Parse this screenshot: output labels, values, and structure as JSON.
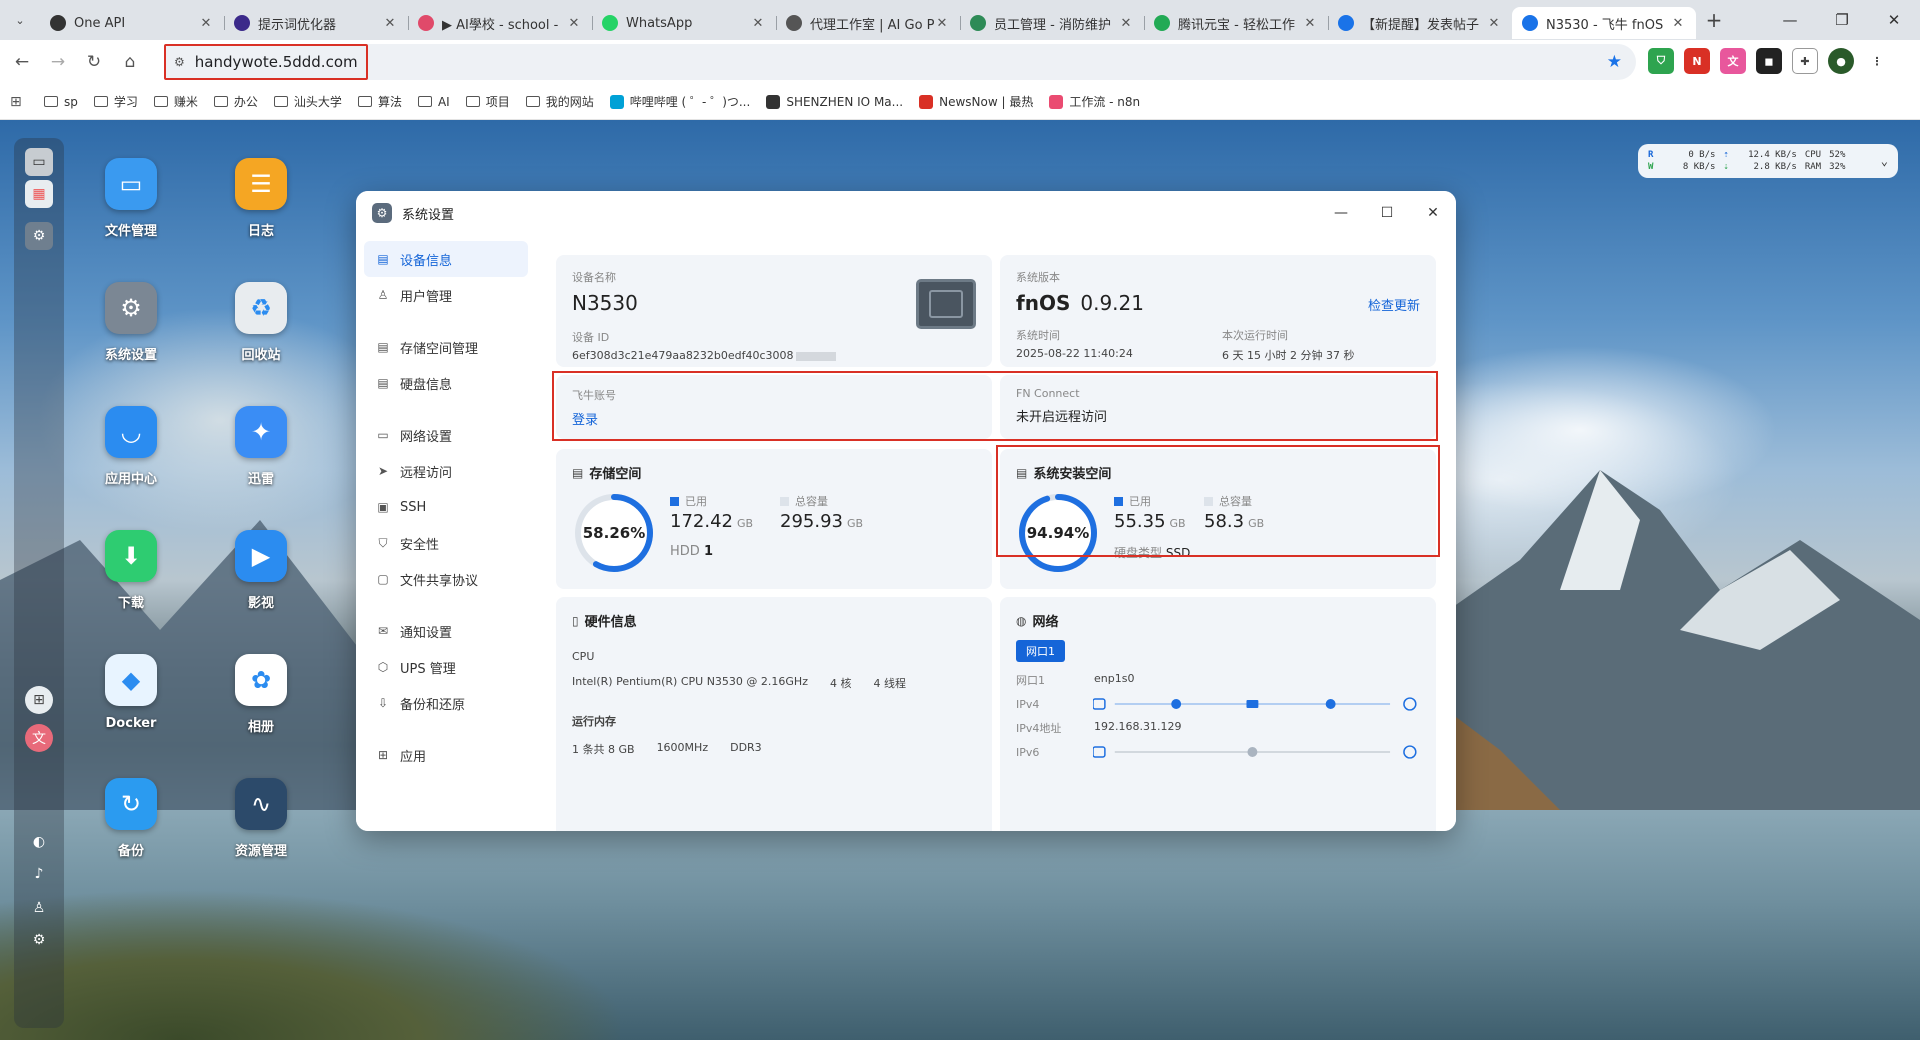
{
  "browser": {
    "tabs": [
      {
        "title": "One API",
        "color": "#333333",
        "active": false
      },
      {
        "title": "提示词优化器",
        "color": "#3b2a8a",
        "active": false
      },
      {
        "title": "▶ AI學校 - school -",
        "color": "#e04a6a",
        "active": false
      },
      {
        "title": "WhatsApp",
        "color": "#25d366",
        "active": false
      },
      {
        "title": "代理工作室 | AI Go P",
        "color": "#555555",
        "active": false
      },
      {
        "title": "员工管理 - 消防维护",
        "color": "#2e8b57",
        "active": false
      },
      {
        "title": "腾讯元宝 - 轻松工作",
        "color": "#22aa55",
        "active": false
      },
      {
        "title": "【新提醒】发表帖子",
        "color": "#1a73e8",
        "active": false
      },
      {
        "title": "N3530 - 飞牛 fnOS",
        "color": "#1a73e8",
        "active": true
      }
    ],
    "url": "handywote.5ddd.com",
    "bookmarks": [
      {
        "label": "sp",
        "type": "folder"
      },
      {
        "label": "学习",
        "type": "folder"
      },
      {
        "label": "赚米",
        "type": "folder"
      },
      {
        "label": "办公",
        "type": "folder"
      },
      {
        "label": "汕头大学",
        "type": "folder"
      },
      {
        "label": "算法",
        "type": "folder"
      },
      {
        "label": "AI",
        "type": "folder"
      },
      {
        "label": "项目",
        "type": "folder"
      },
      {
        "label": "我的网站",
        "type": "folder"
      },
      {
        "label": "哔哩哔哩 ( ゜- ゜)つ...",
        "type": "site",
        "color": "#00a1d6"
      },
      {
        "label": "SHENZHEN IO Ma...",
        "type": "site",
        "color": "#333333"
      },
      {
        "label": "NewsNow | 最热",
        "type": "site",
        "color": "#d93025"
      },
      {
        "label": "工作流 - n8n",
        "type": "site",
        "color": "#ea4b71"
      }
    ]
  },
  "desktop": {
    "icons": [
      {
        "label": "文件管理",
        "color": "#3a9af0",
        "glyph": "▭"
      },
      {
        "label": "日志",
        "color": "#f5a623",
        "glyph": "☰"
      },
      {
        "label": "系统设置",
        "color": "#7b8794",
        "glyph": "⚙"
      },
      {
        "label": "回收站",
        "color": "#e8ecef",
        "glyph": "♻"
      },
      {
        "label": "应用中心",
        "color": "#2b8cf0",
        "glyph": "◡"
      },
      {
        "label": "迅雷",
        "color": "#3a8df5",
        "glyph": "✦"
      },
      {
        "label": "下载",
        "color": "#2ecc71",
        "glyph": "⬇"
      },
      {
        "label": "影视",
        "color": "#2b8cf0",
        "glyph": "▶"
      },
      {
        "label": "Docker",
        "color": "#e8f4ff",
        "glyph": "◆"
      },
      {
        "label": "相册",
        "color": "#ffffff",
        "glyph": "✿"
      },
      {
        "label": "备份",
        "color": "#2b9bf0",
        "glyph": "↻"
      },
      {
        "label": "资源管理",
        "color": "#2c4a6a",
        "glyph": "∿"
      }
    ],
    "monitor": {
      "r_label": "R",
      "w_label": "W",
      "r_disk": "0  B/s",
      "w_disk": "8 KB/s",
      "up": "12.4 KB/s",
      "down": "2.8 KB/s",
      "cpu_label": "CPU",
      "ram_label": "RAM",
      "cpu": "52%",
      "ram": "32%"
    }
  },
  "window": {
    "title": "系统设置",
    "sidebar": [
      {
        "label": "设备信息",
        "icon": "▤",
        "active": true
      },
      {
        "label": "用户管理",
        "icon": "♙",
        "active": false
      },
      {
        "gap": true
      },
      {
        "label": "存储空间管理",
        "icon": "▤",
        "active": false
      },
      {
        "label": "硬盘信息",
        "icon": "▤",
        "active": false
      },
      {
        "gap": true
      },
      {
        "label": "网络设置",
        "icon": "▭",
        "active": false
      },
      {
        "label": "远程访问",
        "icon": "➤",
        "active": false
      },
      {
        "label": "SSH",
        "icon": "▣",
        "active": false
      },
      {
        "label": "安全性",
        "icon": "⛉",
        "active": false
      },
      {
        "label": "文件共享协议",
        "icon": "▢",
        "active": false
      },
      {
        "gap": true
      },
      {
        "label": "通知设置",
        "icon": "✉",
        "active": false
      },
      {
        "label": "UPS 管理",
        "icon": "⬡",
        "active": false
      },
      {
        "label": "备份和还原",
        "icon": "⇩",
        "active": false
      },
      {
        "gap": true
      },
      {
        "label": "应用",
        "icon": "⊞",
        "active": false
      }
    ],
    "device": {
      "name_label": "设备名称",
      "name": "N3530",
      "id_label": "设备 ID",
      "id": "6ef308d3c21e479aa8232b0edf40c3008"
    },
    "system": {
      "version_label": "系统版本",
      "os": "fnOS",
      "version": "0.9.21",
      "check_update": "检查更新",
      "time_label": "系统时间",
      "time": "2025-08-22 11:40:24",
      "uptime_label": "本次运行时间",
      "uptime": "6 天 15 小时 2 分钟 37 秒"
    },
    "account": {
      "feiniu_label": "飞牛账号",
      "feiniu_action": "登录",
      "fn_connect_label": "FN Connect",
      "fn_connect_status": "未开启远程访问"
    },
    "storage": {
      "title": "存储空间",
      "percent": "58.26%",
      "ratio": 0.5826,
      "used_label": "已用",
      "used": "172.42",
      "used_unit": "GB",
      "total_label": "总容量",
      "total": "295.93",
      "total_unit": "GB",
      "disk_type": "HDD",
      "disk_count": "1",
      "ring_color": "#1e6fe0",
      "track_color": "#dde3ea"
    },
    "sys_space": {
      "title": "系统安装空间",
      "percent": "94.94%",
      "ratio": 0.9494,
      "used_label": "已用",
      "used": "55.35",
      "used_unit": "GB",
      "total_label": "总容量",
      "total": "58.3",
      "total_unit": "GB",
      "disk_type_label": "硬盘类型",
      "disk_type": "SSD"
    },
    "hardware": {
      "title": "硬件信息",
      "cpu_label": "CPU",
      "cpu_model": "Intel(R) Pentium(R) CPU N3530 @ 2.16GHz",
      "cores": "4 核",
      "threads": "4 线程",
      "mem_label": "运行内存",
      "mem_size": "1 条共 8 GB",
      "mem_freq": "1600MHz",
      "mem_type": "DDR3"
    },
    "network": {
      "title": "网络",
      "tab": "网口1",
      "nic_label": "网口1",
      "nic": "enp1s0",
      "ipv4_label": "IPv4",
      "ipv4_addr_label": "IPv4地址",
      "ipv4_addr": "192.168.31.129",
      "ipv6_label": "IPv6"
    }
  }
}
